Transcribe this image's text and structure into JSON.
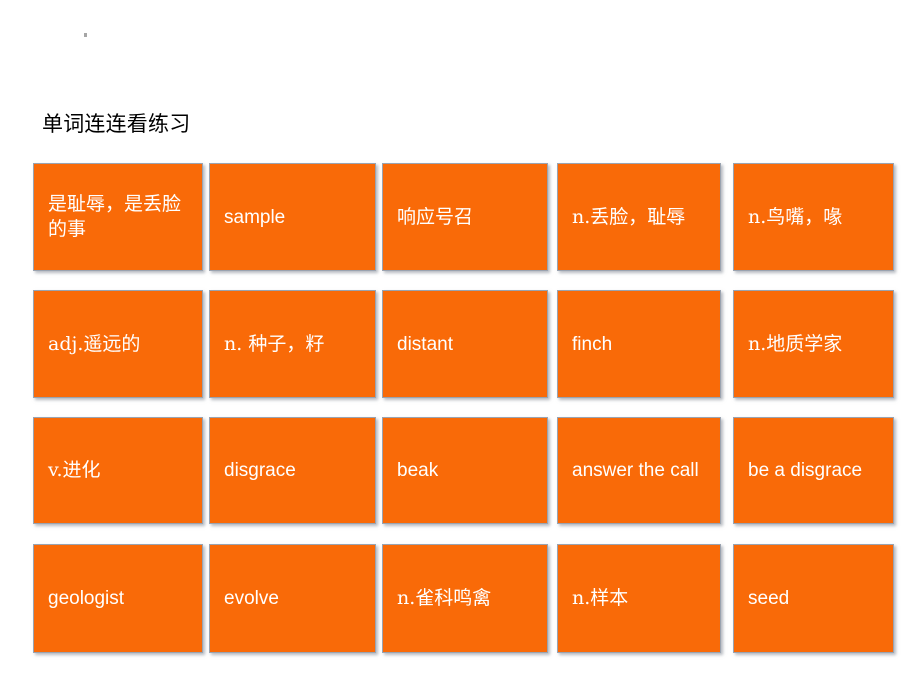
{
  "slide": {
    "title": "单词连连看练习",
    "background_color": "#ffffff",
    "card_color": "#f96a08",
    "card_text_color": "#ffffff",
    "title_color": "#000000"
  },
  "grid": {
    "rows": 4,
    "columns": 5
  },
  "cards": [
    {
      "id": "r1c1",
      "label": "是耻辱，是丢脸的事",
      "lang": "zh"
    },
    {
      "id": "r1c2",
      "label": "sample",
      "lang": "en"
    },
    {
      "id": "r1c3",
      "label": "响应号召",
      "lang": "zh"
    },
    {
      "id": "r1c4",
      "label": "n.丢脸，耻辱",
      "lang": "zh"
    },
    {
      "id": "r1c5",
      "label": "n.鸟嘴，喙",
      "lang": "zh"
    },
    {
      "id": "r2c1",
      "label": "adj.遥远的",
      "lang": "zh"
    },
    {
      "id": "r2c2",
      "label": "n. 种子，籽",
      "lang": "zh"
    },
    {
      "id": "r2c3",
      "label": "distant",
      "lang": "en"
    },
    {
      "id": "r2c4",
      "label": "finch",
      "lang": "en"
    },
    {
      "id": "r2c5",
      "label": "n.地质学家",
      "lang": "zh"
    },
    {
      "id": "r3c1",
      "label": "v.进化",
      "lang": "zh"
    },
    {
      "id": "r3c2",
      "label": "disgrace",
      "lang": "en"
    },
    {
      "id": "r3c3",
      "label": "beak",
      "lang": "en"
    },
    {
      "id": "r3c4",
      "label": "answer the call",
      "lang": "en"
    },
    {
      "id": "r3c5",
      "label": "be a disgrace",
      "lang": "en"
    },
    {
      "id": "r4c1",
      "label": "geologist",
      "lang": "en"
    },
    {
      "id": "r4c2",
      "label": "evolve",
      "lang": "en"
    },
    {
      "id": "r4c3",
      "label": "n.雀科鸣禽",
      "lang": "zh"
    },
    {
      "id": "r4c4",
      "label": "n.样本",
      "lang": "zh"
    },
    {
      "id": "r4c5",
      "label": "seed",
      "lang": "en"
    }
  ]
}
